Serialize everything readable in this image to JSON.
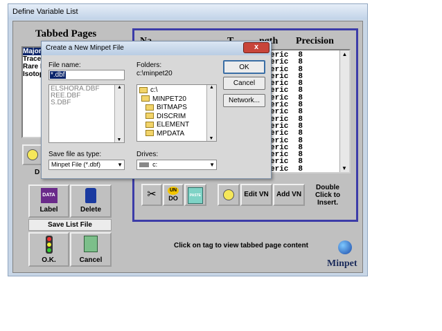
{
  "window": {
    "title": "Define Variable List"
  },
  "tabbed": {
    "title": "Tabbed Pages",
    "items": [
      "Major",
      "Trace",
      "Rare I",
      "Isotop"
    ]
  },
  "left_buttons": {
    "d_label": "D",
    "label": "Label",
    "delete": "Delete",
    "save_list": "Save List File",
    "ok": "O.K.",
    "cancel": "Cancel",
    "data_icon_text": "DATA"
  },
  "table": {
    "headers": [
      "Na",
      "T",
      "ngth",
      "Precision"
    ],
    "rows": [
      {
        "type": "eric",
        "len": "8"
      },
      {
        "type": "eric",
        "len": "8"
      },
      {
        "type": "eric",
        "len": "8"
      },
      {
        "type": "eric",
        "len": "8"
      },
      {
        "type": "eric",
        "len": "8"
      },
      {
        "type": "eric",
        "len": "8"
      },
      {
        "type": "eric",
        "len": "8"
      },
      {
        "type": "eric",
        "len": "8"
      },
      {
        "type": "eric",
        "len": "8"
      },
      {
        "type": "eric",
        "len": "8"
      },
      {
        "type": "eric",
        "len": "8"
      },
      {
        "type": "eric",
        "len": "8"
      },
      {
        "type": "eric",
        "len": "8"
      },
      {
        "type": "eric",
        "len": "8"
      },
      {
        "type": "eric",
        "len": "8"
      },
      {
        "type": "eric",
        "len": "8"
      },
      {
        "type": "eric",
        "len": "8"
      }
    ]
  },
  "right_buttons": {
    "undo_top": "UN",
    "undo_bottom": "DO",
    "paste": "PASTE",
    "edit_vn": "Edit VN",
    "add_vn": "Add VN",
    "double_click": "Double Click to Insert."
  },
  "status": {
    "hint": "Click on tag to view tabbed page content",
    "brand": "Minpet"
  },
  "dialog": {
    "title": "Create a New Minpet File",
    "close": "x",
    "file_name_label": "File name:",
    "file_name_value": "*.dbf",
    "files": [
      "ELSHORA.DBF",
      "REE.DBF",
      "S.DBF"
    ],
    "folders_label": "Folders:",
    "folders_path": "c:\\minpet20",
    "folders": [
      "c:\\",
      "MINPET20",
      "BITMAPS",
      "DISCRIM",
      "ELEMENT",
      "MPDATA"
    ],
    "ok": "OK",
    "cancel": "Cancel",
    "network": "Network...",
    "save_type_label": "Save file as type:",
    "save_type_value": "Minpet File (*.dbf)",
    "drives_label": "Drives:",
    "drives_value": "c:"
  }
}
